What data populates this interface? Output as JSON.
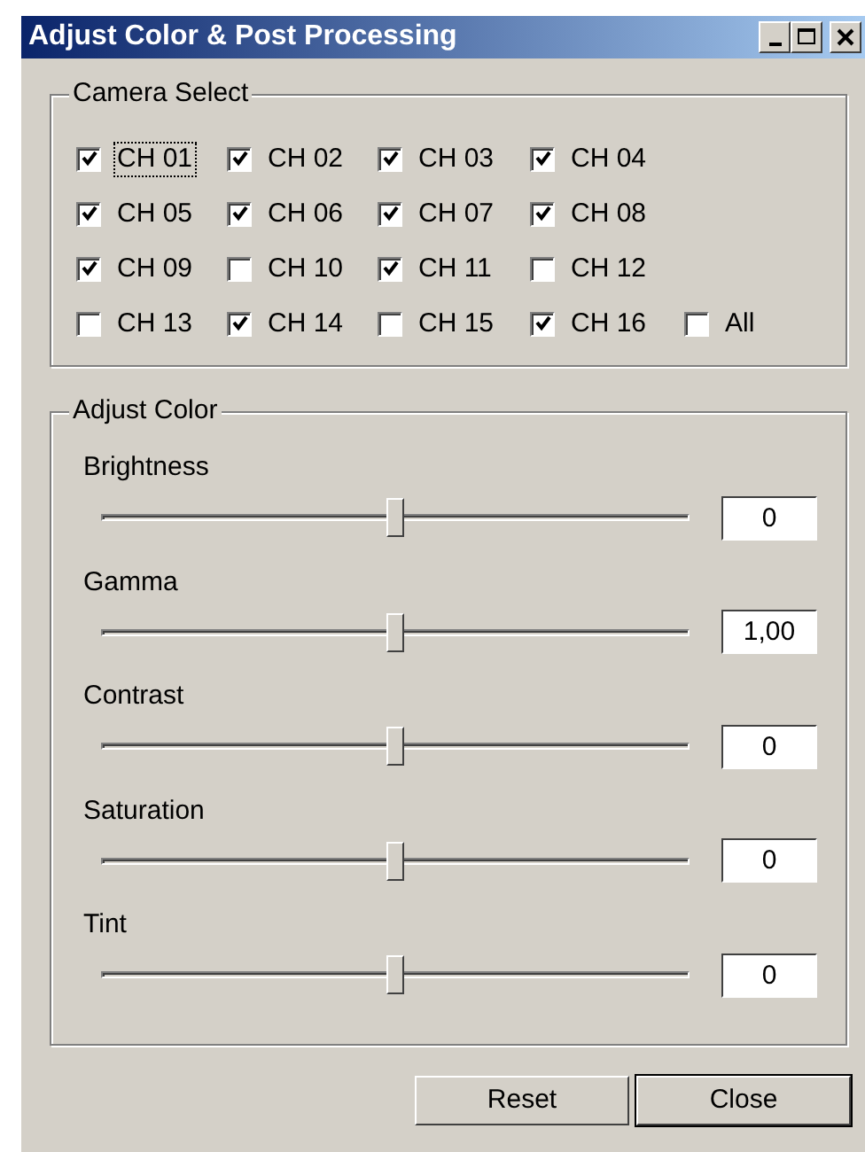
{
  "window": {
    "title": "Adjust Color & Post Processing"
  },
  "camera_select": {
    "title": "Camera Select",
    "rows": [
      [
        {
          "label": "CH 01",
          "checked": true,
          "focused": true
        },
        {
          "label": "CH 02",
          "checked": true,
          "focused": false
        },
        {
          "label": "CH 03",
          "checked": true,
          "focused": false
        },
        {
          "label": "CH 04",
          "checked": true,
          "focused": false
        }
      ],
      [
        {
          "label": "CH 05",
          "checked": true,
          "focused": false
        },
        {
          "label": "CH 06",
          "checked": true,
          "focused": false
        },
        {
          "label": "CH 07",
          "checked": true,
          "focused": false
        },
        {
          "label": "CH 08",
          "checked": true,
          "focused": false
        }
      ],
      [
        {
          "label": "CH 09",
          "checked": true,
          "focused": false
        },
        {
          "label": "CH 10",
          "checked": false,
          "focused": false
        },
        {
          "label": "CH 11",
          "checked": true,
          "focused": false
        },
        {
          "label": "CH 12",
          "checked": false,
          "focused": false
        }
      ],
      [
        {
          "label": "CH 13",
          "checked": false,
          "focused": false
        },
        {
          "label": "CH 14",
          "checked": true,
          "focused": false
        },
        {
          "label": "CH 15",
          "checked": false,
          "focused": false
        },
        {
          "label": "CH 16",
          "checked": true,
          "focused": false
        },
        {
          "label": "All",
          "checked": false,
          "focused": false
        }
      ]
    ]
  },
  "adjust_color": {
    "title": "Adjust Color",
    "sliders": [
      {
        "label": "Brightness",
        "level": 0.5,
        "value": "0"
      },
      {
        "label": "Gamma",
        "level": 0.5,
        "value": "1,00"
      },
      {
        "label": "Contrast",
        "level": 0.5,
        "value": "0"
      },
      {
        "label": "Saturation",
        "level": 0.5,
        "value": "0"
      },
      {
        "label": "Tint",
        "level": 0.5,
        "value": "0"
      }
    ]
  },
  "buttons": [
    {
      "label": "Reset",
      "default": false
    },
    {
      "label": "Close",
      "default": true
    }
  ]
}
